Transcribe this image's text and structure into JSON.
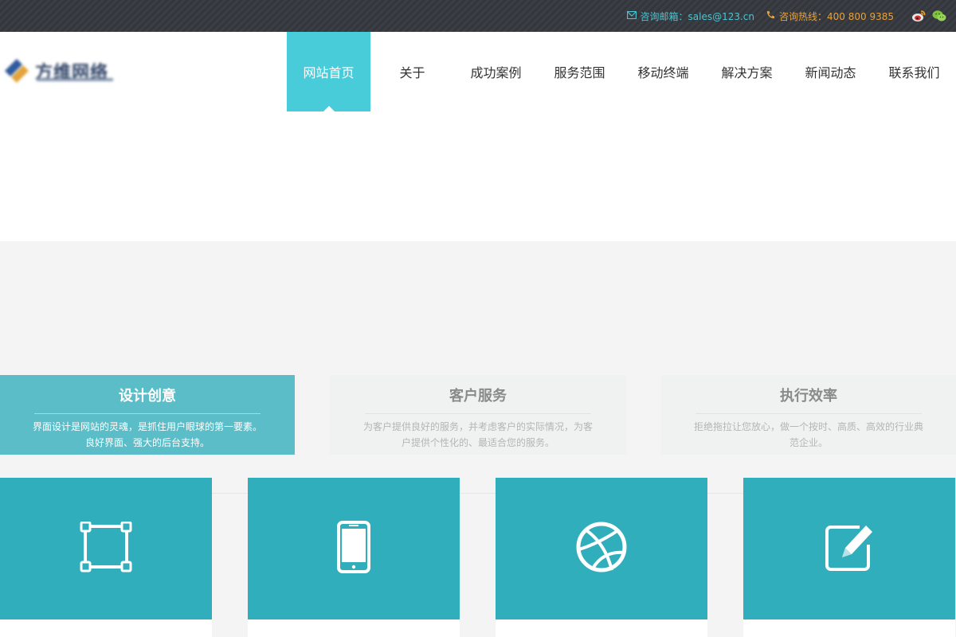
{
  "topbar": {
    "email_label": "咨询邮箱：sales@123.cn",
    "phone_label": "咨询热线：400 800 9385",
    "icons": [
      "mail-icon",
      "phone-icon",
      "weibo-icon",
      "wechat-icon"
    ],
    "colors": {
      "email": "#4ec3d1",
      "phone": "#e8a23a"
    }
  },
  "header": {
    "logo_text": "方维网络",
    "nav": [
      {
        "label": "网站首页",
        "active": true
      },
      {
        "label": "关于",
        "active": false
      },
      {
        "label": "成功案例",
        "active": false
      },
      {
        "label": "服务范围",
        "active": false
      },
      {
        "label": "移动终端",
        "active": false
      },
      {
        "label": "解决方案",
        "active": false
      },
      {
        "label": "新闻动态",
        "active": false
      },
      {
        "label": "联系我们",
        "active": false
      }
    ],
    "accent_color": "#49ccd9"
  },
  "features": [
    {
      "title": "设计创意",
      "desc": "界面设计是网站的灵魂，是抓住用户眼球的第一要素。良好界面、强大的后台支持。",
      "active": true
    },
    {
      "title": "客户服务",
      "desc": "为客户提供良好的服务，并考虑客户的实际情况，为客户提供个性化的、最适合您的服务。",
      "active": false
    },
    {
      "title": "执行效率",
      "desc": "拒绝拖拉让您放心，做一个按时、高质、高效的行业典范企业。",
      "active": false
    }
  ],
  "services": [
    {
      "icon": "crop-frame-icon"
    },
    {
      "icon": "mobile-phone-icon"
    },
    {
      "icon": "dribbble-ball-icon"
    },
    {
      "icon": "edit-pencil-icon"
    }
  ],
  "card_color": "#31aebb"
}
